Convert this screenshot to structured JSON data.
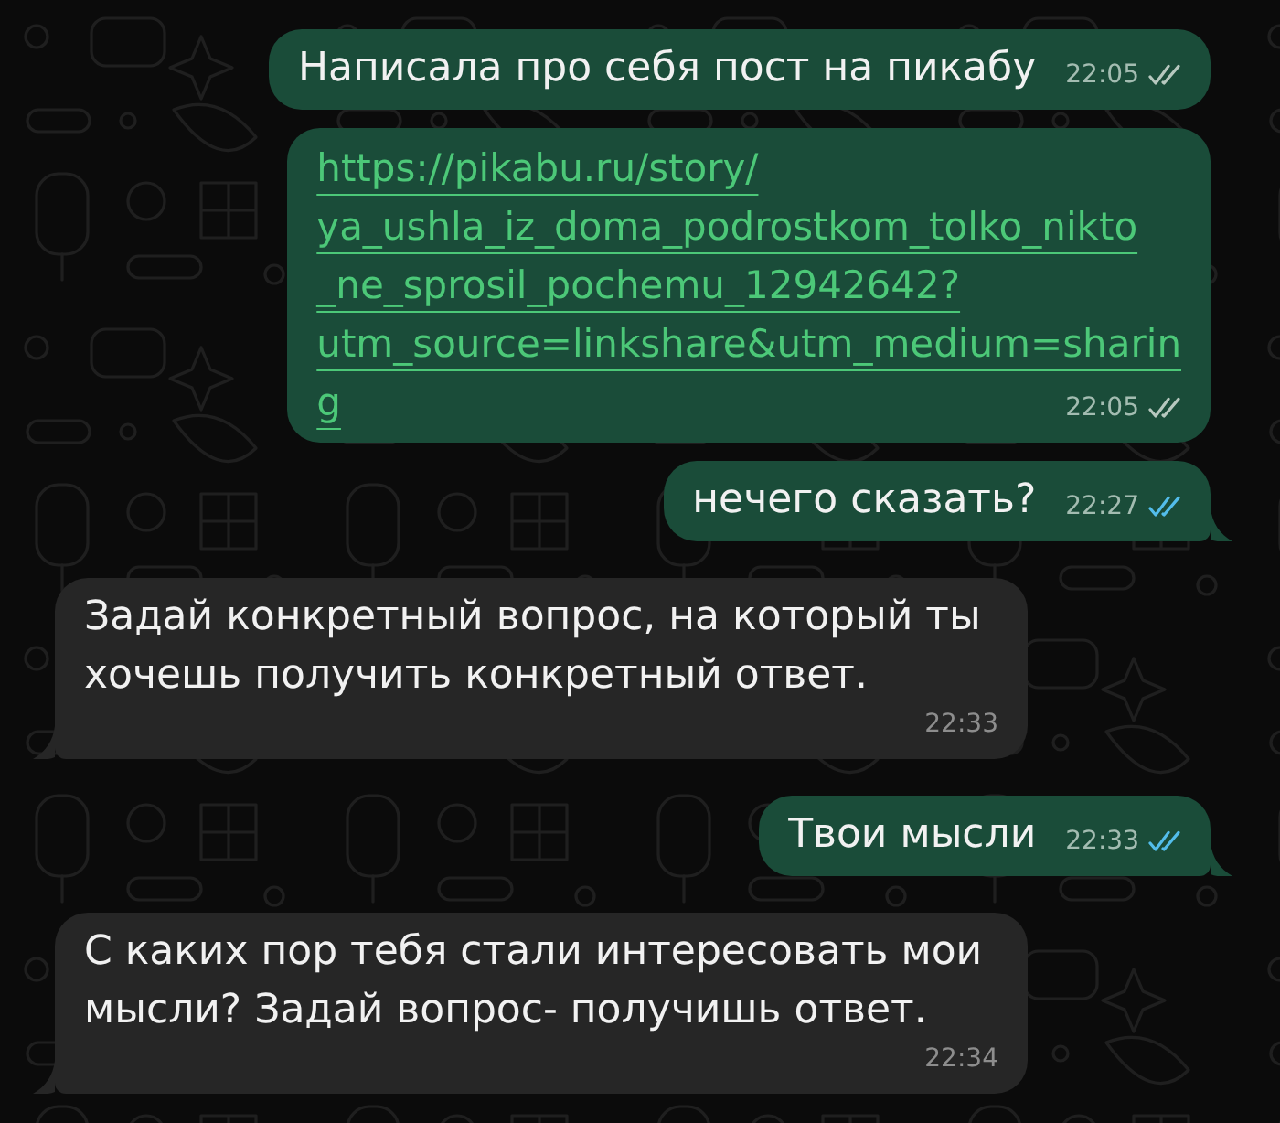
{
  "messages": [
    {
      "outgoing": true,
      "kind": "text",
      "text": "Написала про себя пост на пикабу",
      "time": "22:05",
      "read": false
    },
    {
      "outgoing": true,
      "kind": "link",
      "lines": [
        "https://pikabu.ru/story/",
        "ya_ushla_iz_doma_podrostkom_tolko_nikto",
        "_ne_sprosil_pochemu_12942642?",
        "utm_source=linkshare&utm_medium=sharin",
        "g"
      ],
      "time": "22:05",
      "read": false
    },
    {
      "outgoing": true,
      "kind": "text",
      "text": "нечего сказать?",
      "time": "22:27",
      "read": true
    },
    {
      "outgoing": false,
      "kind": "text",
      "text": "Задай конкретный вопрос, на который ты хочешь получить конкретный ответ.",
      "time": "22:33"
    },
    {
      "outgoing": true,
      "kind": "text",
      "text": "Твои мысли",
      "time": "22:33",
      "read": true
    },
    {
      "outgoing": false,
      "kind": "text",
      "text": "С каких пор тебя стали интересовать мои мысли? Задай вопрос- получишь ответ.",
      "time": "22:34"
    }
  ]
}
